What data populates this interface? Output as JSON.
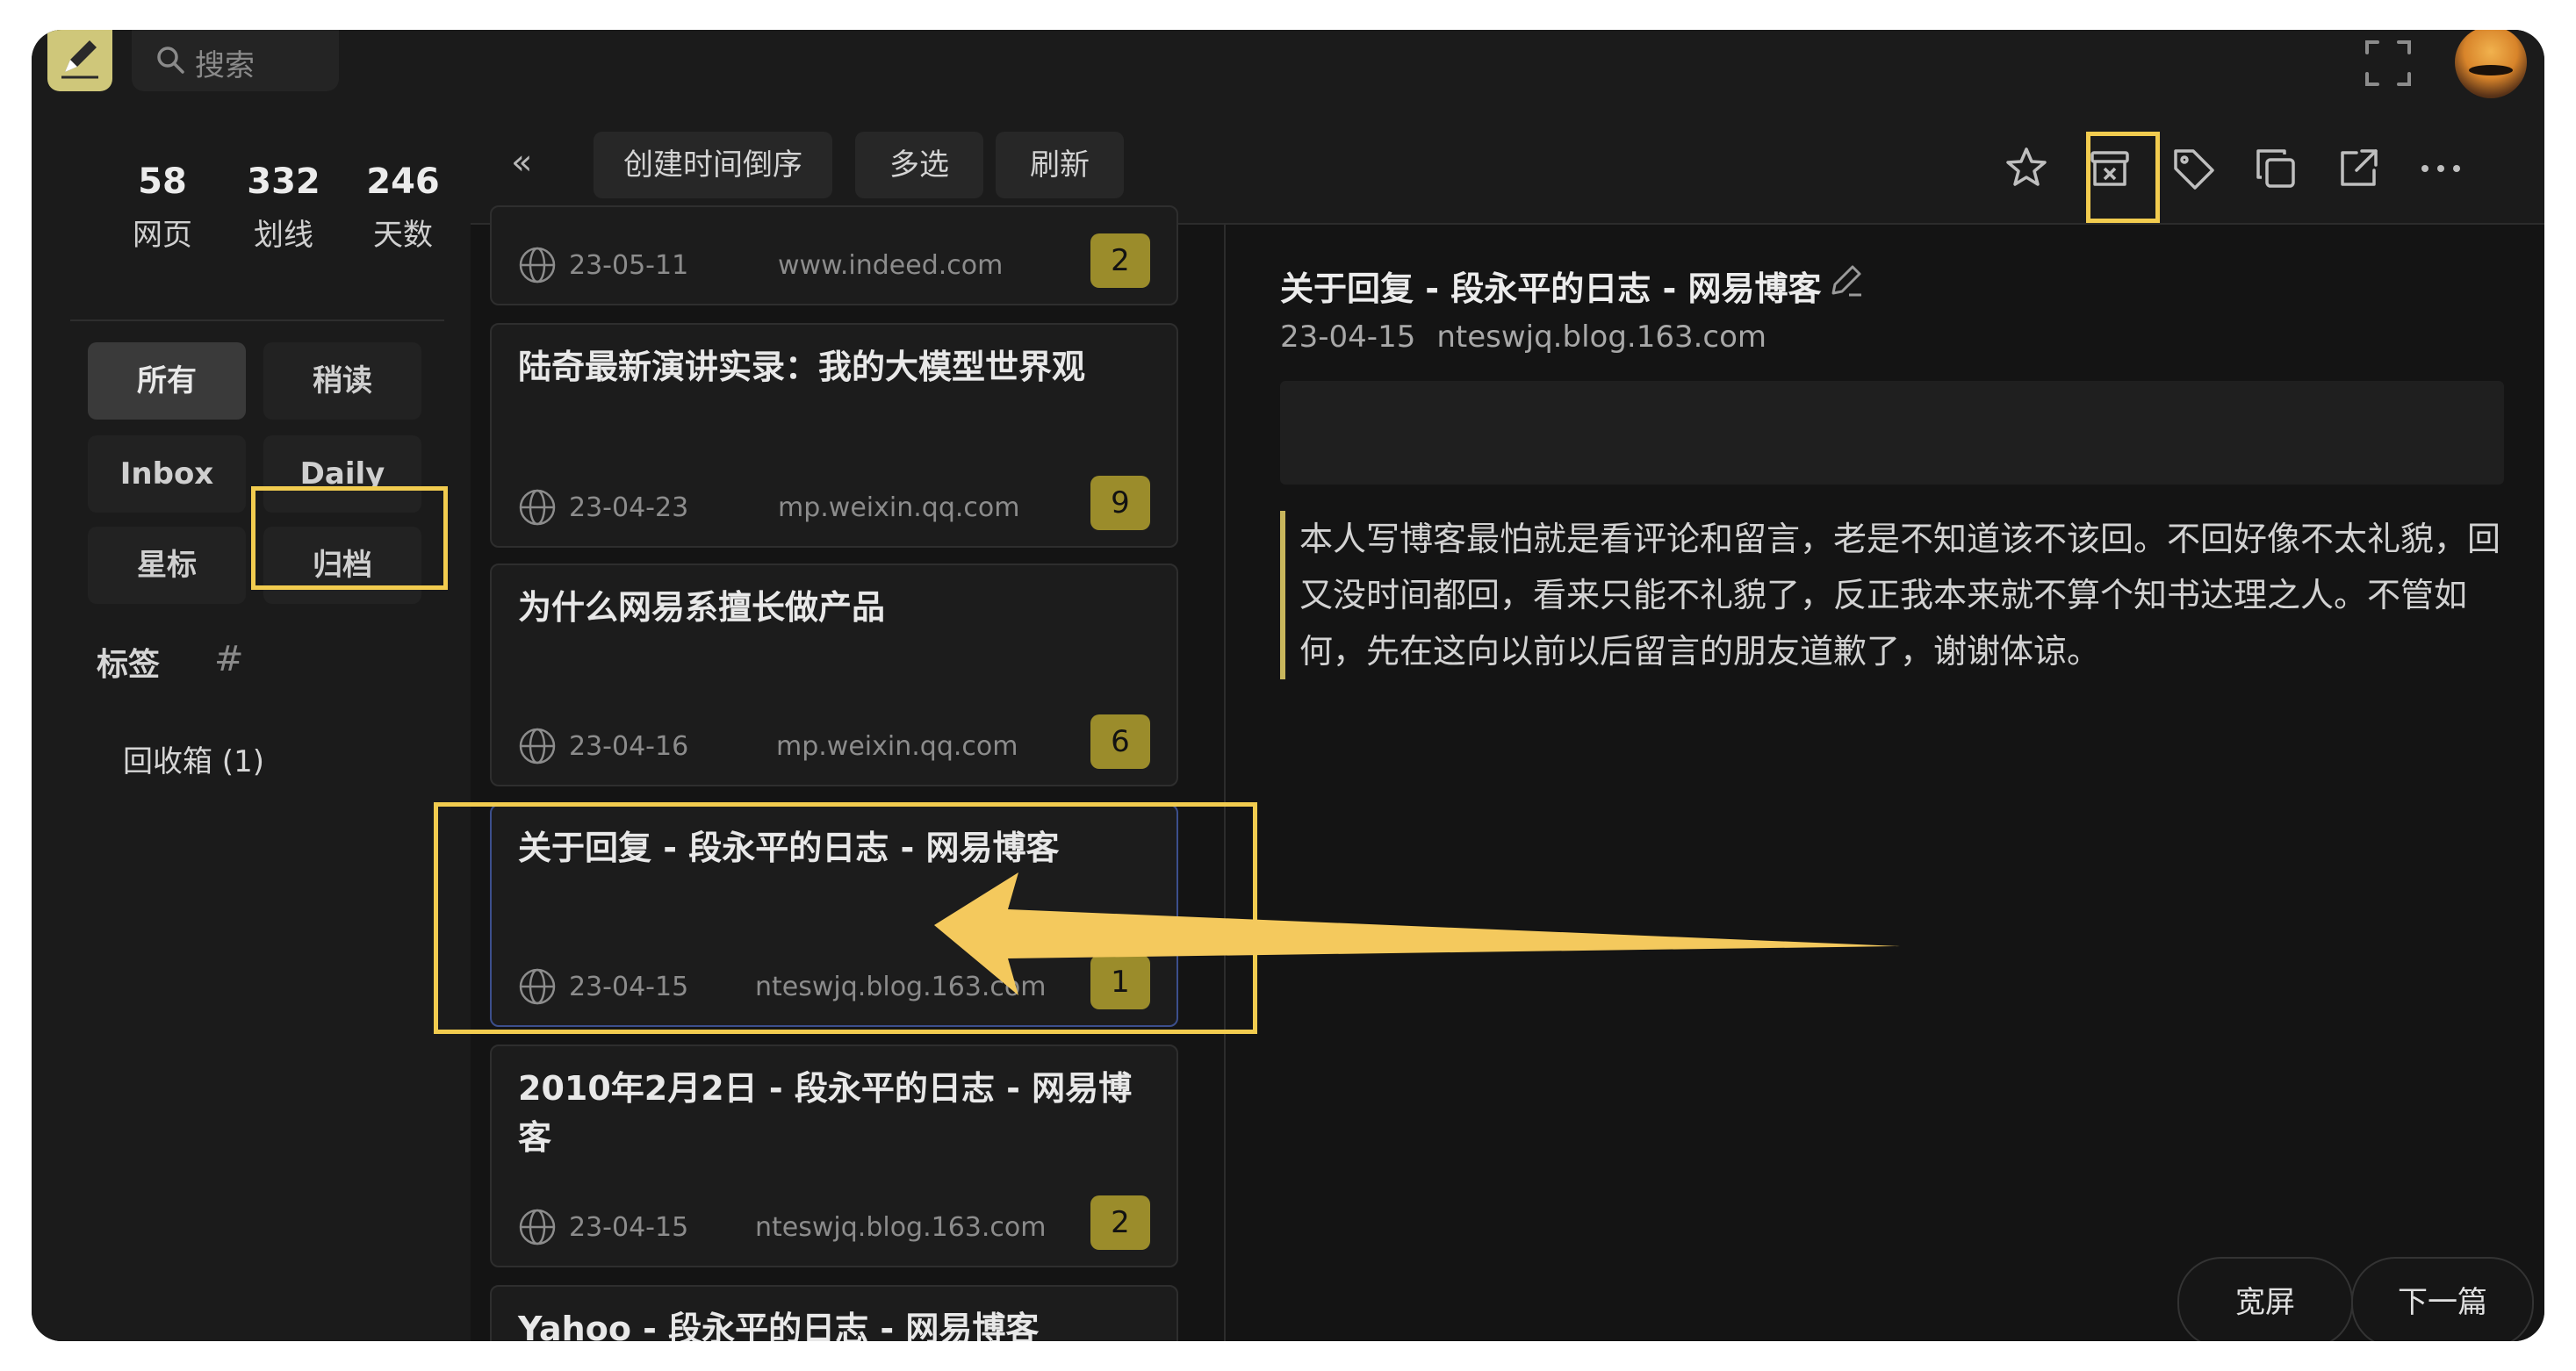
{
  "topbar": {
    "search_placeholder": "搜索",
    "icons": [
      "app-logo-icon",
      "search-icon",
      "fullscreen-icon",
      "avatar"
    ]
  },
  "sidebar": {
    "stats": [
      {
        "num": "58",
        "label": "网页"
      },
      {
        "num": "332",
        "label": "划线"
      },
      {
        "num": "246",
        "label": "天数"
      }
    ],
    "filters": [
      {
        "label": "所有",
        "active": true
      },
      {
        "label": "稍读",
        "active": false
      },
      {
        "label": "Inbox",
        "active": false
      },
      {
        "label": "Daily",
        "active": false
      },
      {
        "label": "星标",
        "active": false
      },
      {
        "label": "归档",
        "active": false
      }
    ],
    "tags_label": "标签",
    "tags_hash": "#",
    "trash_label": "回收箱 (1)"
  },
  "list": {
    "collapse": "«",
    "sort_label": "创建时间倒序",
    "multi_label": "多选",
    "refresh_label": "刷新",
    "items": [
      {
        "title": "",
        "date": "23-05-11",
        "domain": "www.indeed.com",
        "count": "2"
      },
      {
        "title": "陆奇最新演讲实录：我的大模型世界观",
        "date": "23-04-23",
        "domain": "mp.weixin.qq.com",
        "count": "9"
      },
      {
        "title": "为什么网易系擅长做产品",
        "date": "23-04-16",
        "domain": "mp.weixin.qq.com",
        "count": "6"
      },
      {
        "title": "关于回复 - 段永平的日志 - 网易博客",
        "date": "23-04-15",
        "domain": "nteswjq.blog.163.com",
        "count": "1"
      },
      {
        "title": "2010年2月2日 - 段永平的日志 - 网易博客",
        "date": "23-04-15",
        "domain": "nteswjq.blog.163.com",
        "count": "2"
      },
      {
        "title": "Yahoo - 段永平的日志 - 网易博客",
        "date": "",
        "domain": "",
        "count": ""
      }
    ]
  },
  "reader": {
    "toolbar_icons": [
      "star-icon",
      "archive-icon",
      "tag-icon",
      "copy-icon",
      "open-external-icon",
      "more-icon"
    ],
    "title": "关于回复 - 段永平的日志 - 网易博客",
    "date": "23-04-15",
    "domain": "nteswjq.blog.163.com",
    "quote": "本人写博客最怕就是看评论和留言，老是不知道该不该回。不回好像不太礼貌，回又没时间都回，看来只能不礼貌了，反正我本来就不算个知书达理之人。不管如何，先在这向以前以后留言的朋友道歉了，谢谢体谅。",
    "widescreen_label": "宽屏",
    "next_label": "下一篇"
  },
  "colors": {
    "highlight": "#f2cc4f",
    "badge": "#9b8c2b",
    "quote_bar": "#c8b65c",
    "background": "#141414"
  }
}
